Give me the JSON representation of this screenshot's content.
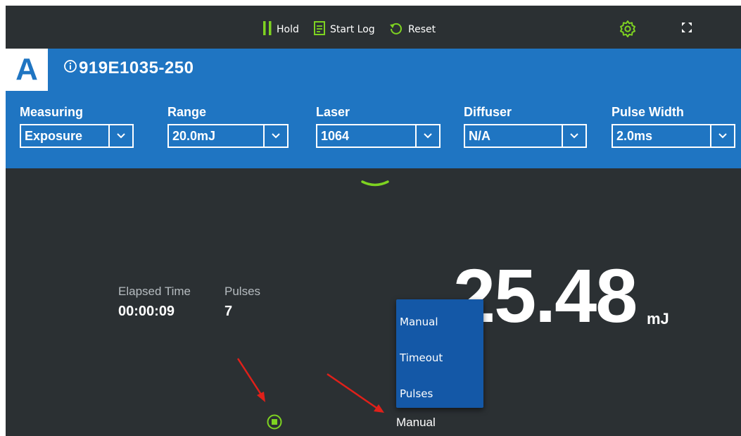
{
  "toolbar": {
    "hold_label": "Hold",
    "start_log_label": "Start Log",
    "reset_label": "Reset",
    "icons": [
      "pause-icon",
      "log-icon",
      "reset-icon",
      "gear-icon",
      "fullscreen-icon"
    ],
    "accent_color": "#7ed321"
  },
  "header": {
    "channel": "A",
    "serial": "919E1035-250",
    "background_color": "#1f75c2",
    "fields": [
      {
        "label": "Measuring",
        "value": "Exposure"
      },
      {
        "label": "Range",
        "value": "20.0mJ"
      },
      {
        "label": "Laser",
        "value": "1064"
      },
      {
        "label": "Diffuser",
        "value": "N/A"
      },
      {
        "label": "Pulse Width",
        "value": "2.0ms"
      }
    ]
  },
  "stats": {
    "elapsed_label": "Elapsed Time",
    "elapsed_value": "00:00:09",
    "pulses_label": "Pulses",
    "pulses_value": "7"
  },
  "reading": {
    "value": "25.48",
    "unit": "mJ"
  },
  "mode": {
    "current": "Manual",
    "menu_items": [
      "Manual",
      "Timeout",
      "Pulses"
    ]
  },
  "annotations": {
    "arrow_color": "#e0201a"
  }
}
